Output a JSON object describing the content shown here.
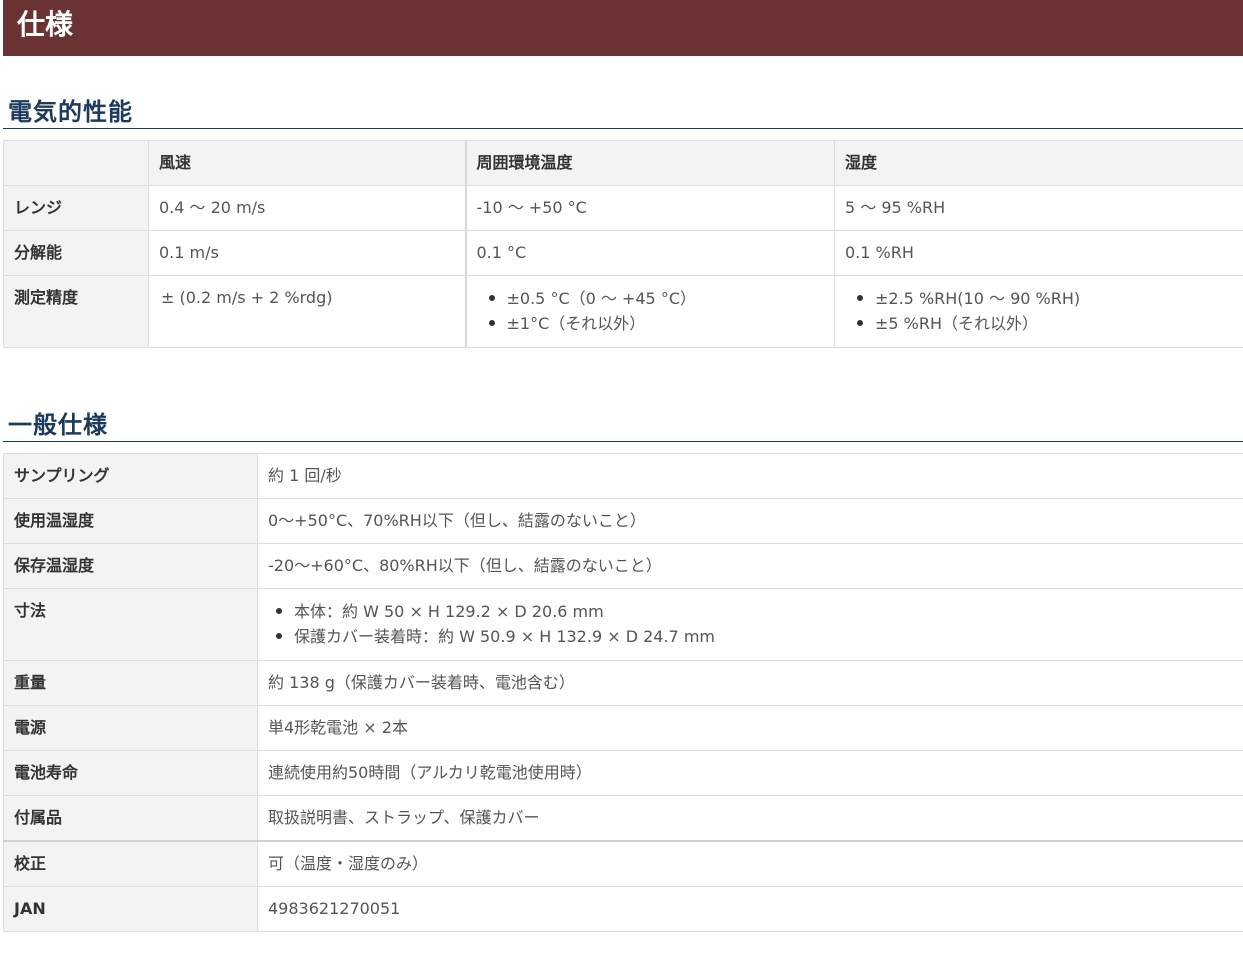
{
  "banner": {
    "title": "仕様"
  },
  "electrical": {
    "title": "電気的性能",
    "headers": [
      "",
      "風速",
      "周囲環境温度",
      "湿度"
    ],
    "rows": [
      {
        "label": "レンジ",
        "cells": [
          "0.4 ～ 20 m/s",
          "-10 ～ +50 °C",
          "5 ～ 95 %RH"
        ]
      },
      {
        "label": "分解能",
        "cells": [
          "0.1 m/s",
          "0.1 °C",
          "0.1 %RH"
        ]
      },
      {
        "label": "測定精度",
        "cells": [
          "± (0.2 m/s + 2 %rdg)",
          [
            "±0.5 °C（0 ～ +45 °C）",
            "±1°C（それ以外）"
          ],
          [
            "±2.5 %RH(10 ～ 90 %RH)",
            "±5 %RH（それ以外）"
          ]
        ]
      }
    ]
  },
  "general": {
    "title": "一般仕様",
    "rows": [
      {
        "label": "サンプリング",
        "value": "約 1 回/秒"
      },
      {
        "label": "使用温湿度",
        "value": "0～+50°C、70%RH以下（但し、結露のないこと）"
      },
      {
        "label": "保存温湿度",
        "value": "-20～+60°C、80%RH以下（但し、結露のないこと）"
      },
      {
        "label": "寸法",
        "items": [
          "本体：約 W 50 × H 129.2 × D 20.6 mm",
          "保護カバー装着時：約 W 50.9 × H 132.9 × D 24.7 mm"
        ]
      },
      {
        "label": "重量",
        "value": "約 138 g（保護カバー装着時、電池含む）"
      },
      {
        "label": "電源",
        "value": "単4形乾電池 × 2本"
      },
      {
        "label": "電池寿命",
        "value": "連続使用約50時間（アルカリ乾電池使用時）"
      },
      {
        "label": "付属品",
        "value": "取扱説明書、ストラップ、保護カバー"
      },
      {
        "label": "校正",
        "value": "可（温度・湿度のみ）"
      },
      {
        "label": "JAN",
        "value": "4983621270051"
      }
    ]
  },
  "colors": {
    "banner_bg": "#6a3232",
    "heading": "#1b3a5c",
    "label_bg": "#f3f3f3"
  }
}
